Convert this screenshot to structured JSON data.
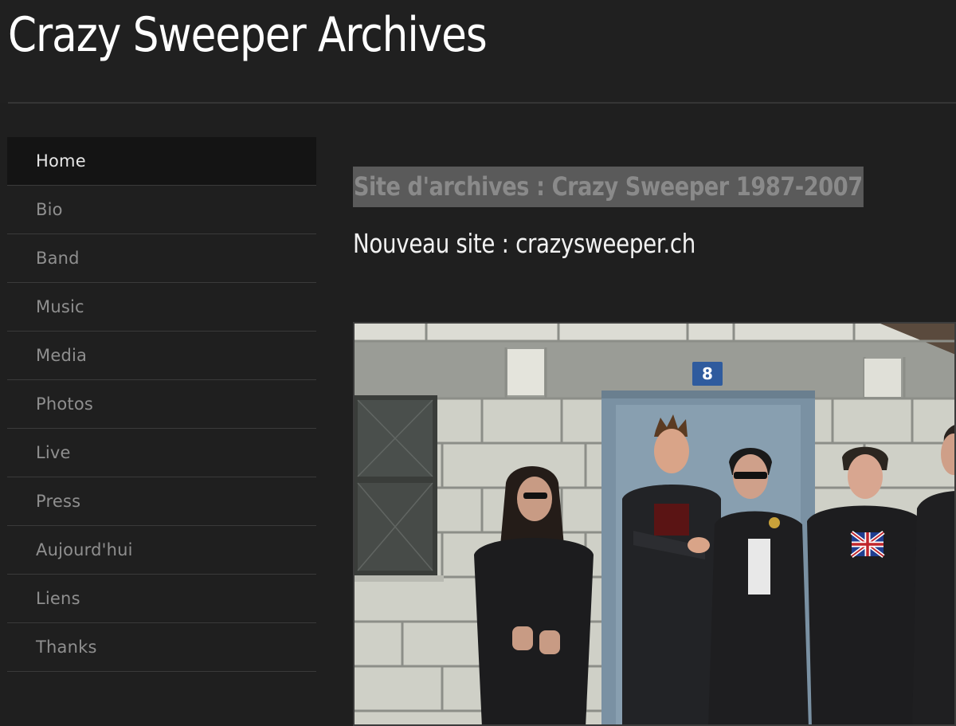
{
  "site": {
    "title": "Crazy Sweeper Archives"
  },
  "nav": {
    "items": [
      {
        "label": "Home",
        "active": true
      },
      {
        "label": "Bio"
      },
      {
        "label": "Band"
      },
      {
        "label": "Music"
      },
      {
        "label": "Media"
      },
      {
        "label": "Photos"
      },
      {
        "label": "Live"
      },
      {
        "label": "Press"
      },
      {
        "label": "Aujourd'hui"
      },
      {
        "label": "Liens"
      },
      {
        "label": "Thanks"
      }
    ]
  },
  "main": {
    "heading": "Site d'archives : Crazy Sweeper 1987-2007",
    "new_site_prefix": "Nouveau site : ",
    "new_site_link": "crazysweeper.ch",
    "photo": {
      "door_number": "8",
      "kind": "band photo in front of a brick wall and blue door"
    }
  },
  "colors": {
    "background": "#1f1f1f",
    "active_nav": "#141414",
    "heading_highlight": "#5a5a5a",
    "nav_text": "#8f8f8f",
    "door": "#7f95a6"
  }
}
